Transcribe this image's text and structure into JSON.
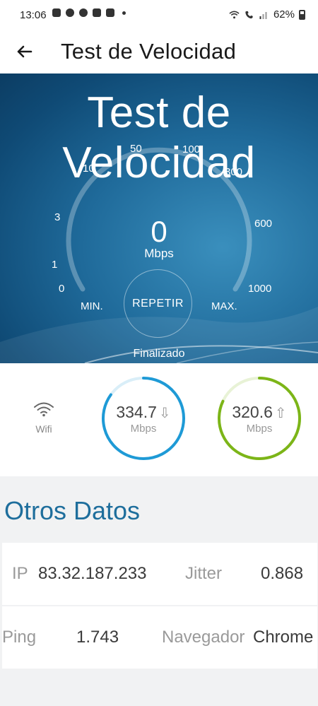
{
  "status_bar": {
    "time": "13:06",
    "battery": "62%"
  },
  "toolbar": {
    "back_icon": "arrow-left-icon",
    "title": "Test de Velocidad"
  },
  "hero": {
    "title": "Test de Velocidad",
    "ticks": [
      "0",
      "1",
      "3",
      "10",
      "50",
      "100",
      "300",
      "600",
      "1000"
    ],
    "speed_value": "0",
    "speed_unit": "Mbps",
    "min_label": "MIN.",
    "max_label": "MAX.",
    "repeat_label": "REPETIR",
    "status": "Finalizado"
  },
  "results": {
    "connection_icon": "wifi-icon",
    "connection_label": "Wifi",
    "download": {
      "value": "334.7",
      "unit": "Mbps",
      "arrow": "⇩",
      "color": "#1e9ad6",
      "fill": 0.85
    },
    "upload": {
      "value": "320.6",
      "unit": "Mbps",
      "arrow": "⇧",
      "color": "#7cb518",
      "fill": 0.82
    }
  },
  "other": {
    "title": "Otros Datos",
    "ip_label": "IP",
    "ip_value": "83.32.187.233",
    "jitter_label": "Jitter",
    "jitter_value": "0.868",
    "ping_label": "Ping",
    "ping_value": "1.743",
    "browser_label": "Navegador",
    "browser_value": "Chrome"
  }
}
